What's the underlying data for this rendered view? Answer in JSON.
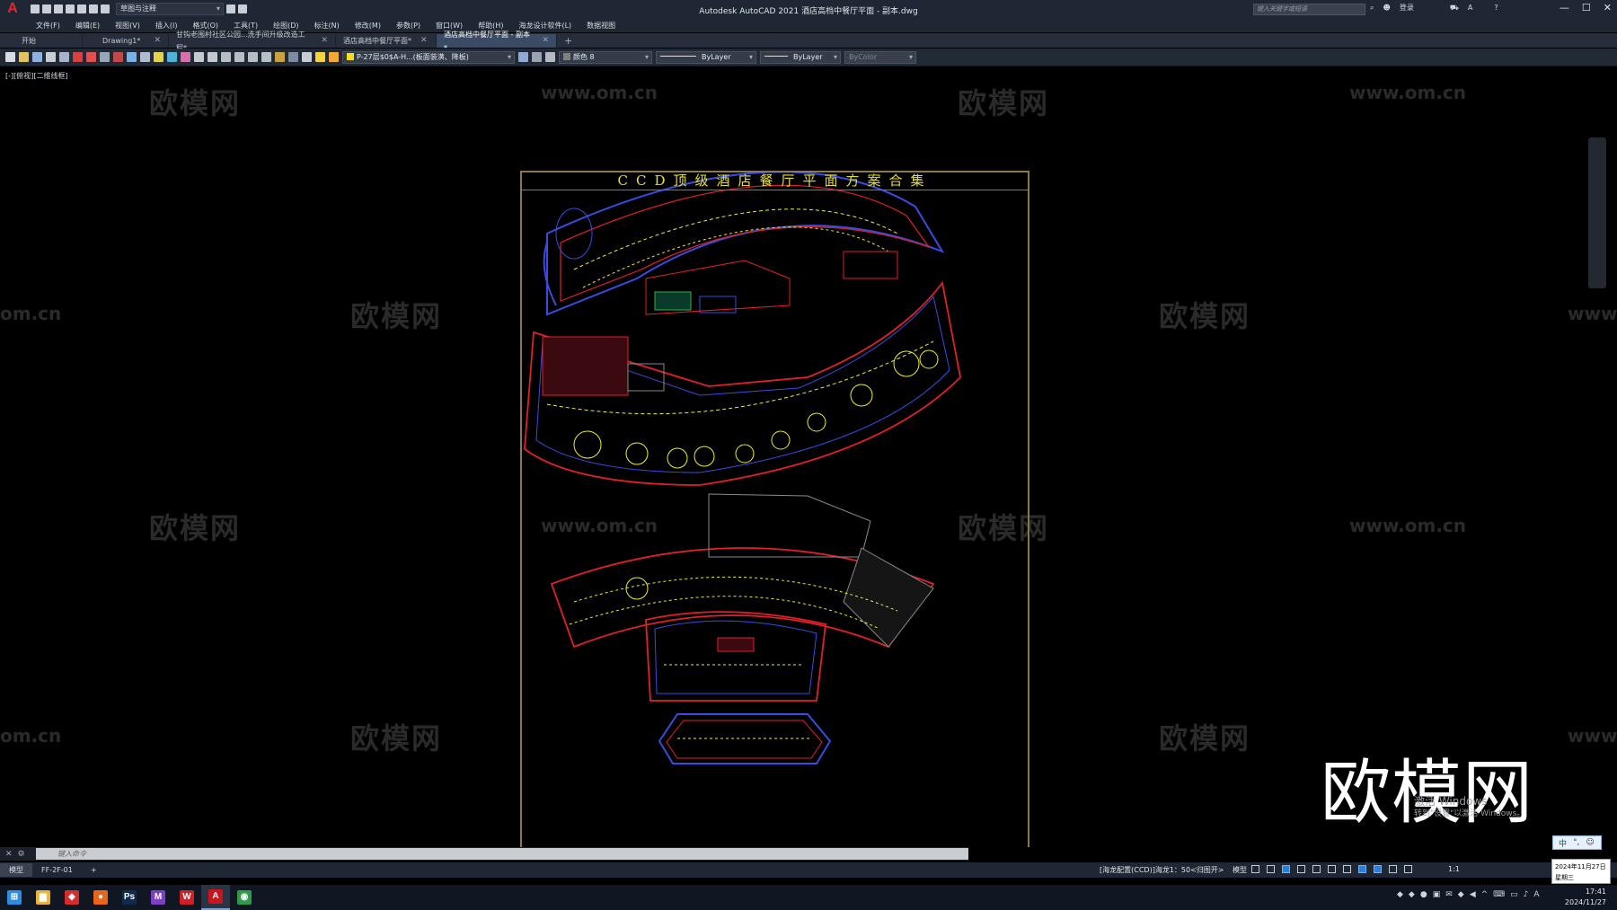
{
  "titlebar": {
    "logo": "A",
    "workspace": "草图与注释",
    "title": "Autodesk AutoCAD 2021    酒店高档中餐厅平面 - 副本.dwg",
    "search_placeholder": "键入关键字或短语",
    "login": "登录",
    "window_controls": [
      "—",
      "☐",
      "✕"
    ]
  },
  "menu": [
    "文件(F)",
    "编辑(E)",
    "视图(V)",
    "插入(I)",
    "格式(O)",
    "工具(T)",
    "绘图(D)",
    "标注(N)",
    "修改(M)",
    "参数(P)",
    "窗口(W)",
    "帮助(H)",
    "海龙设计软件(L)",
    "数据视图"
  ],
  "tabs": [
    {
      "label": "开始",
      "closable": false,
      "active": false
    },
    {
      "label": "Drawing1*",
      "closable": true,
      "active": false
    },
    {
      "label": "甘钩老围村社区公园...洗手间升级改造工程*",
      "closable": true,
      "active": false
    },
    {
      "label": "酒店高档中餐厅平面*",
      "closable": true,
      "active": false
    },
    {
      "label": "酒店高档中餐厅平面 - 副本*",
      "closable": true,
      "active": true
    }
  ],
  "tab_add": "+",
  "toolbar": {
    "layer": "P-27层$0$A-H...(板面装潢、降板)",
    "color": "颜色 8",
    "linetype": "ByLayer",
    "lineweight": "ByLayer",
    "plotstyle": "ByColor",
    "layer_color": "#f2e01c"
  },
  "viewport_label": "[-][俯视][二维线框]",
  "drawing": {
    "title": "CCD顶级酒店餐厅平面方案合集",
    "colors": {
      "frame": "#8b7a45",
      "wall_red": "#e0202a",
      "blue": "#3a4be0",
      "yellow": "#f0f020",
      "green": "#2db34a",
      "grey": "#8a8a8a"
    }
  },
  "watermarks": {
    "brand": "欧模网",
    "url": "www.om.cn",
    "url_short": "om.cn",
    "url_partial": "www."
  },
  "big_logo": "欧模网",
  "activate_windows": {
    "line1": "激活 Windows",
    "line2": "转到\"设置\"以激活 Windows。"
  },
  "command_line": {
    "placeholder": "键入命令"
  },
  "layout_tabs": [
    "模型",
    "FF-2F-01"
  ],
  "layout_add": "+",
  "status": {
    "text": "[海龙配置(CCD)]海龙1：50<归图开>",
    "model": "模型",
    "scale": "1:1"
  },
  "ime": [
    "中",
    "°,",
    "☺"
  ],
  "date_popup": {
    "date": "2024年11月27日",
    "weekday": "星期三"
  },
  "clock": {
    "time": "17:41",
    "date": "2024/11/27"
  },
  "taskbar_apps": [
    {
      "name": "windows-start",
      "glyph": "⊞",
      "color": "#2b8de3"
    },
    {
      "name": "file-explorer",
      "glyph": "▆",
      "color": "#e9b33a"
    },
    {
      "name": "app-red",
      "glyph": "◈",
      "color": "#d72c2c"
    },
    {
      "name": "firefox",
      "glyph": "●",
      "color": "#e8651a"
    },
    {
      "name": "photoshop",
      "glyph": "Ps",
      "color": "#0f2b4f"
    },
    {
      "name": "app-colorful",
      "glyph": "M",
      "color": "#7e3fc7"
    },
    {
      "name": "wps",
      "glyph": "W",
      "color": "#d21f26"
    },
    {
      "name": "autocad",
      "glyph": "A",
      "color": "#c8151c"
    },
    {
      "name": "chrome",
      "glyph": "◉",
      "color": "#2f9a49"
    }
  ]
}
